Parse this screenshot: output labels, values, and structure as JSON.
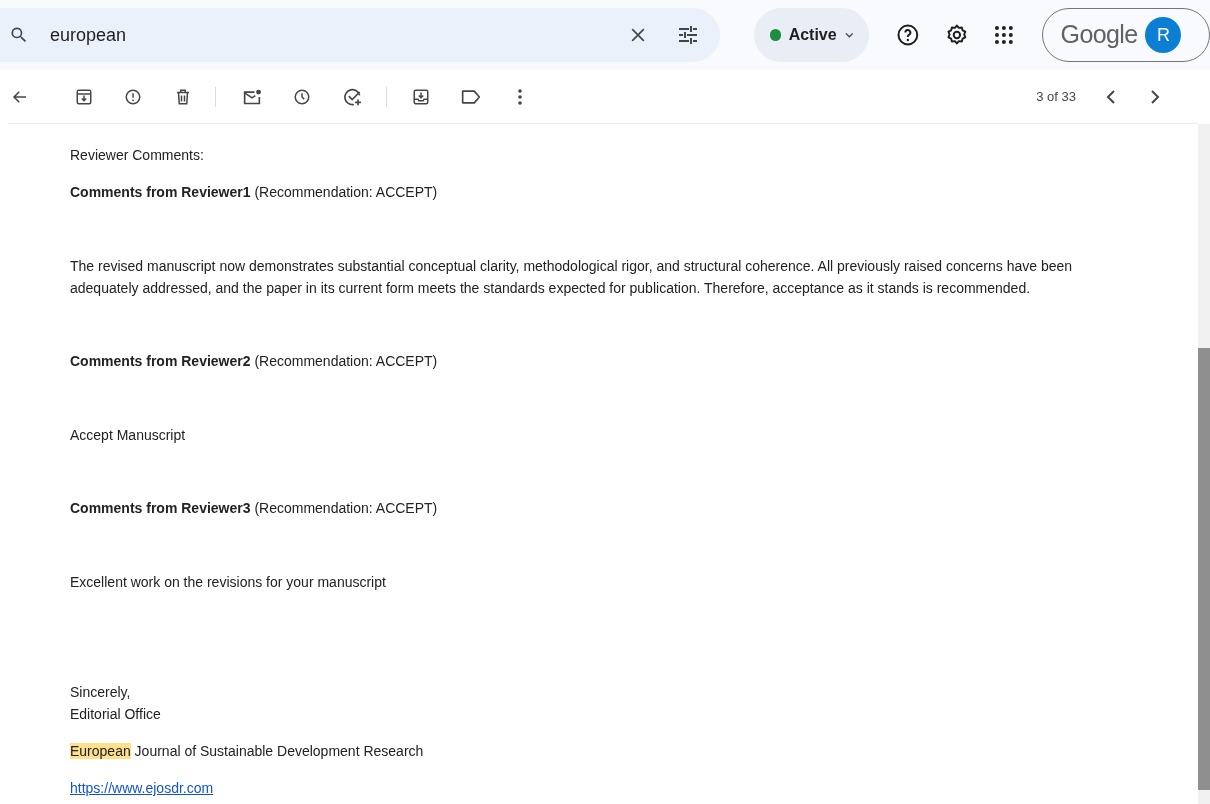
{
  "search": {
    "value": "european"
  },
  "status": {
    "label": "Active",
    "color": "#1e8e3e"
  },
  "account": {
    "brand": "Google",
    "initial": "R"
  },
  "pager": {
    "text": "3 of 33"
  },
  "message": [
    {
      "kind": "label",
      "text": "Reviewer Comments:"
    },
    {
      "kind": "heading",
      "text": "**Comments from Reviewer1** (Recommendation: ACCEPT)"
    },
    {
      "kind": "comment",
      "text": "The revised manuscript now demonstrates substantial conceptual clarity, methodological rigor, and structural coherence. All previously raised concerns have been adequately addressed, and the paper in its current form meets the standards expected for publication. Therefore, acceptance as it stands is recommended."
    },
    {
      "kind": "heading",
      "text": "**Comments from Reviewer2** (Recommendation: ACCEPT)"
    },
    {
      "kind": "comment",
      "text": "Accept Manuscript"
    },
    {
      "kind": "heading",
      "text": "**Comments from Reviewer3** (Recommendation: ACCEPT)"
    },
    {
      "kind": "comment",
      "text": "Excellent work on the revisions for your manuscript"
    },
    {
      "kind": "signature",
      "lines": [
        "Sincerely,",
        "Editorial Office"
      ]
    },
    {
      "kind": "journal",
      "highlight": "European",
      "rest": " Journal of Sustainable Development Research"
    },
    {
      "kind": "link",
      "text": "https://www.ejosdr.com"
    }
  ]
}
